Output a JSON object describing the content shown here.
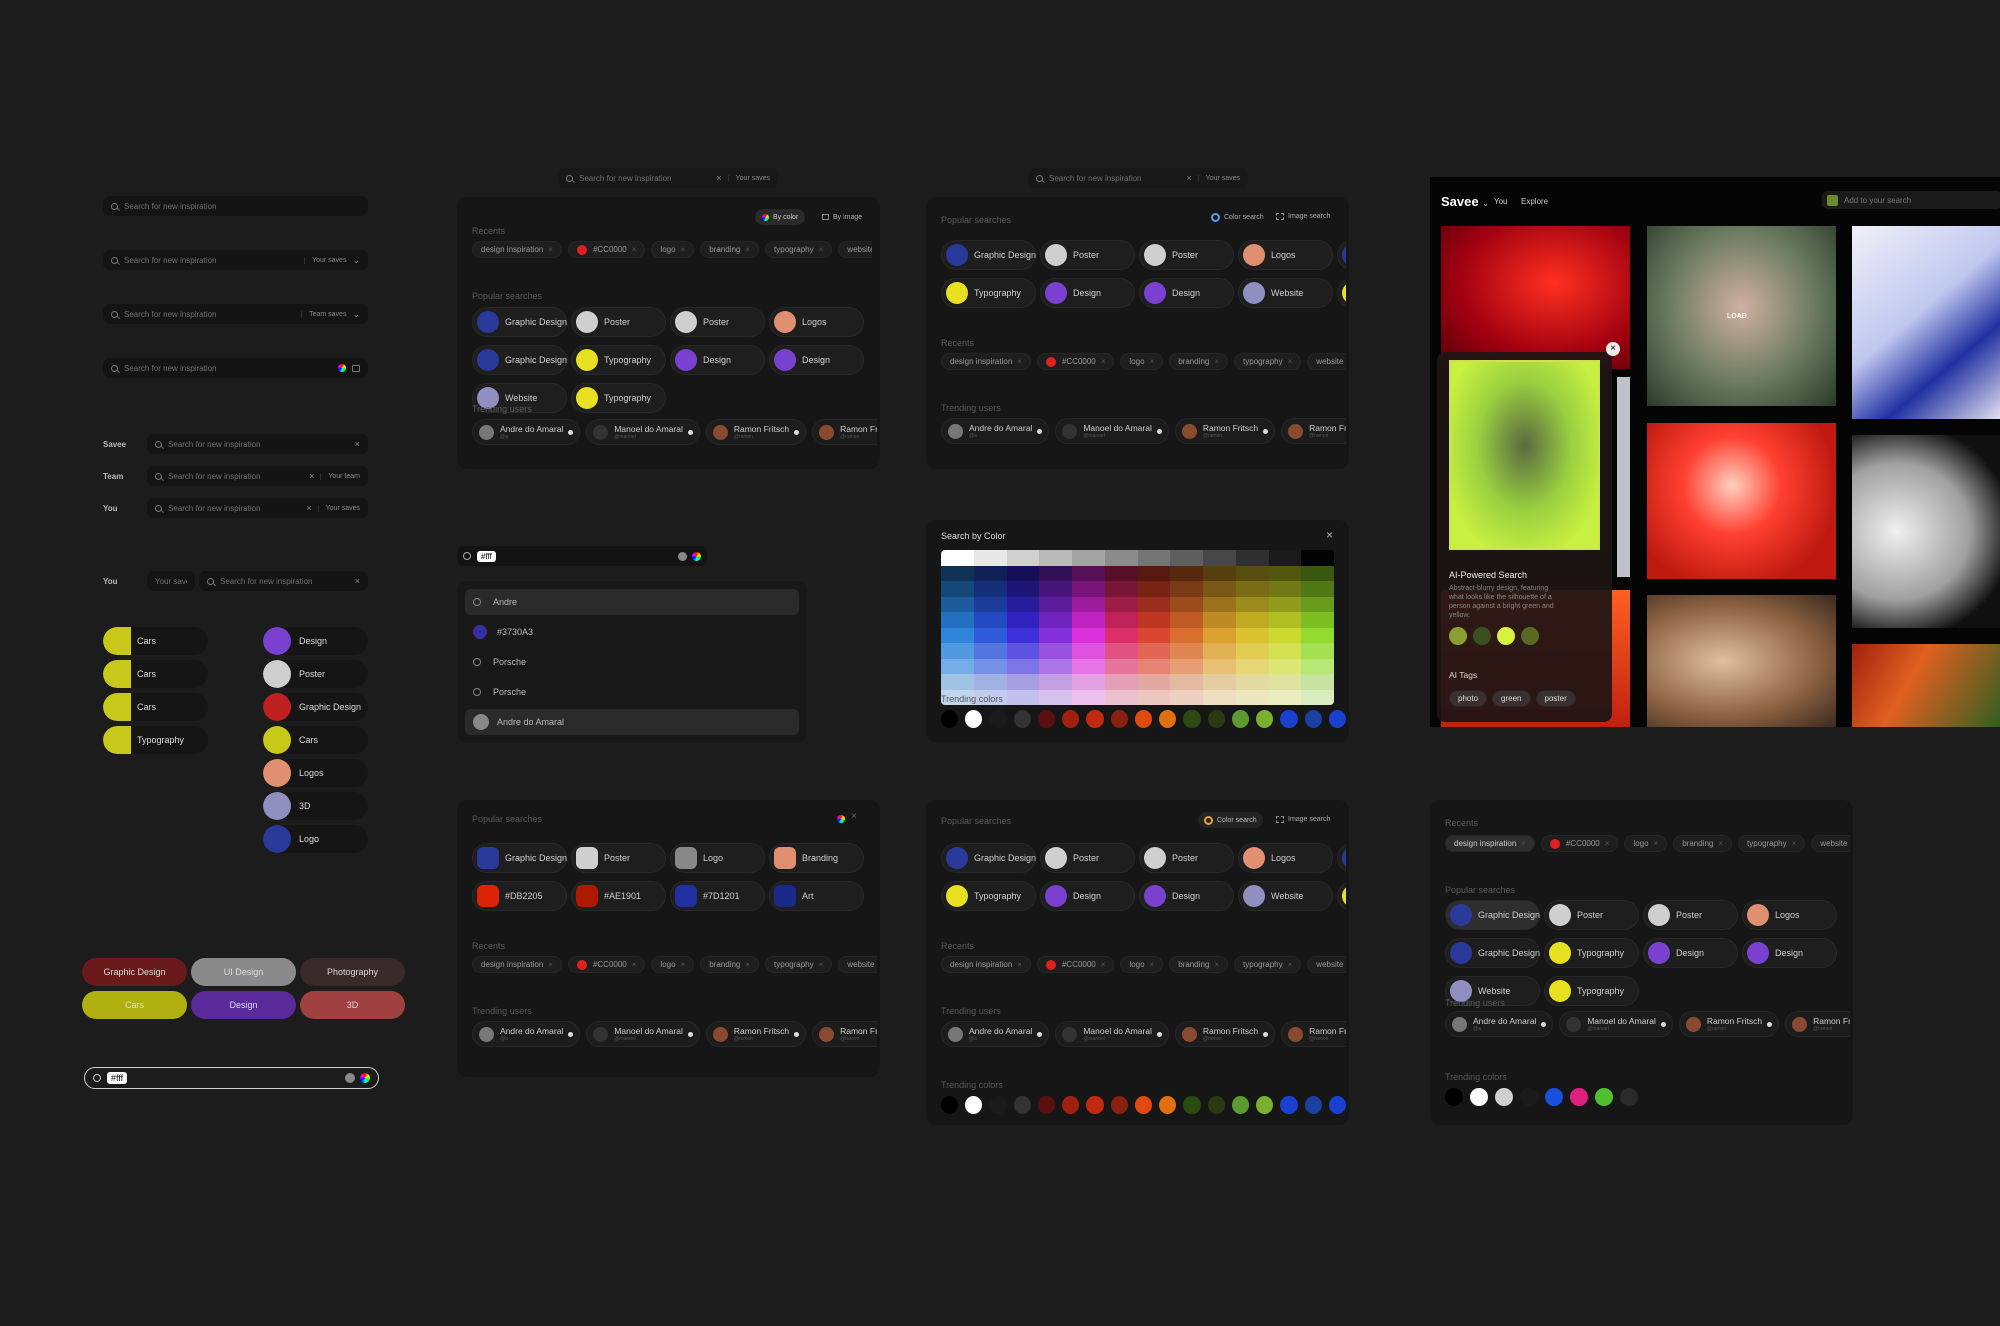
{
  "colors": {
    "bg": "#1c1c1c",
    "panel": "#161616",
    "accent_red": "#e02020",
    "pill": "#1e1e1e"
  },
  "search": {
    "placeholder": "Search for new inspiration",
    "your_saves": "Your saves",
    "team_saves": "Team saves",
    "your_team": "Your team",
    "hex_query": "#fff"
  },
  "rows": {
    "savee": "Savee",
    "team": "Team",
    "you": "You"
  },
  "filters": {
    "by_color": "By color",
    "by_image": "By image",
    "color_search": "Color search",
    "image_search": "Image search"
  },
  "sections": {
    "recents": "Recents",
    "popular": "Popular searches",
    "trending_users": "Trending users",
    "trending_colors": "Trending colors",
    "search_by_color": "Search by Color"
  },
  "recents": [
    "design inspiration",
    "#CC0000",
    "logo",
    "branding",
    "typography",
    "website",
    "website",
    "website"
  ],
  "popular": [
    {
      "label": "Graphic Design",
      "icon": "graphic-design-thumb",
      "color": "#2a3a9a"
    },
    {
      "label": "Poster",
      "icon": "poster-thumb",
      "color": "#cfcfcf"
    },
    {
      "label": "Poster",
      "icon": "poster-thumb",
      "color": "#cfcfcf"
    },
    {
      "label": "Logos",
      "icon": "logos-thumb",
      "color": "#e09070"
    },
    {
      "label": "Typography",
      "icon": "typography-thumb",
      "color": "#e8e020"
    },
    {
      "label": "Design",
      "icon": "design-thumb",
      "color": "#7a40d0"
    },
    {
      "label": "Design",
      "icon": "design-thumb",
      "color": "#7a40d0"
    },
    {
      "label": "Website",
      "icon": "website-thumb",
      "color": "#9090c0"
    }
  ],
  "popular_colors": [
    {
      "label": "Graphic Design",
      "color": "#2a3a9a"
    },
    {
      "label": "Poster",
      "color": "#cfcfcf"
    },
    {
      "label": "Logo",
      "color": "#888888"
    },
    {
      "label": "Branding",
      "color": "#e09070"
    },
    {
      "label": "#DB2205",
      "color": "#db2205"
    },
    {
      "label": "#AE1901",
      "color": "#ae1901"
    },
    {
      "label": "#7D1201",
      "color": "#2030a0"
    },
    {
      "label": "Art",
      "color": "#1a2a8a"
    }
  ],
  "users": [
    {
      "name": "Andre do Amaral",
      "handle": "@a"
    },
    {
      "name": "Manoel do Amaral",
      "handle": "@manoel"
    },
    {
      "name": "Ramon Fritsch",
      "handle": "@ramon"
    },
    {
      "name": "Ramon Fritsch",
      "handle": "@ramon"
    }
  ],
  "suggestions": [
    {
      "label": "Andre",
      "kind": "search"
    },
    {
      "label": "#3730A3",
      "kind": "color",
      "color": "#3730a3"
    },
    {
      "label": "Porsche",
      "kind": "search"
    },
    {
      "label": "Porsche",
      "kind": "search"
    },
    {
      "label": "Andre do Amaral",
      "kind": "user"
    }
  ],
  "side_chips": [
    {
      "label": "Cars",
      "color": "#c8c81a"
    },
    {
      "label": "Cars",
      "color": "#c8c81a"
    },
    {
      "label": "Cars",
      "color": "#c8c81a"
    },
    {
      "label": "Typography",
      "color": "#c8c81a"
    }
  ],
  "side_chips2": [
    {
      "label": "Design",
      "color": "#7a40d0"
    },
    {
      "label": "Poster",
      "color": "#cfcfcf"
    },
    {
      "label": "Graphic Design",
      "color": "#c02020"
    },
    {
      "label": "Cars",
      "color": "#c8c81a"
    },
    {
      "label": "Logos",
      "color": "#e09070"
    },
    {
      "label": "3D",
      "color": "#9090c0"
    },
    {
      "label": "Logo",
      "color": "#2a3a9a"
    }
  ],
  "big_chips": [
    {
      "label": "Graphic Design",
      "color": "#6a1a1a"
    },
    {
      "label": "UI Design",
      "color": "#8a8a8a"
    },
    {
      "label": "Photography",
      "color": "#3a2a2a"
    },
    {
      "label": "Cars",
      "color": "#b0b010"
    },
    {
      "label": "Design",
      "color": "#5a2a9a"
    },
    {
      "label": "3D",
      "color": "#a04040"
    }
  ],
  "trending_colors": [
    "#000000",
    "#ffffff",
    "#1a1a1a",
    "#333333",
    "#5a1010",
    "#a02010",
    "#c02a10",
    "#8a2010",
    "#e04a10",
    "#e07010",
    "#2a4a10",
    "#2a3a10",
    "#5a9a30",
    "#7ab030",
    "#1a40d0",
    "#1a40a0",
    "#1a40d0"
  ],
  "trending_colors_alt": [
    "#000000",
    "#ffffff",
    "#d0d0d0",
    "#1a1a1a",
    "#1a50e0",
    "#e02080",
    "#50c030",
    "#2a2a2a"
  ],
  "app": {
    "brand": "Savee",
    "nav_you": "You",
    "nav_explore": "Explore",
    "add_search": "Add to your search",
    "load": "LOAD"
  },
  "ai": {
    "title": "AI-Powered Search",
    "desc": "Abstract-blurry design, featuring what looks like the silhouette of a person against a bright green and yellow.",
    "tags_title": "AI Tags",
    "tags": [
      "photo",
      "green",
      "poster"
    ],
    "palette": [
      "#8aa030",
      "#3a5020",
      "#d8f040",
      "#5a6a20"
    ]
  }
}
